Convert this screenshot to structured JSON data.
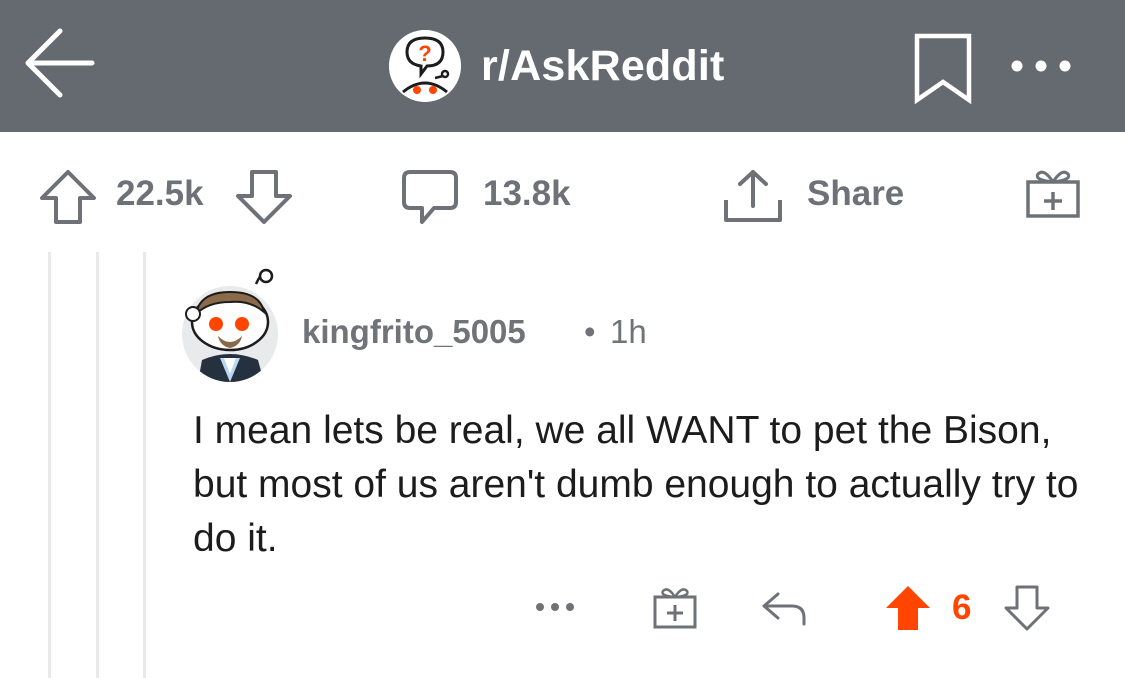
{
  "header": {
    "subreddit": "r/AskReddit",
    "icons": {
      "back": "back-arrow-icon",
      "subreddit": "askreddit-snoo-icon",
      "bookmark": "bookmark-icon",
      "more": "more-horizontal-icon"
    },
    "background_color": "#656a71"
  },
  "post_actions": {
    "upvotes": "22.5k",
    "comments": "13.8k",
    "share_label": "Share",
    "icons": {
      "upvote": "upvote-arrow-icon",
      "downvote": "downvote-arrow-icon",
      "comments": "comment-bubble-icon",
      "share": "share-icon",
      "award": "gift-award-icon"
    }
  },
  "comment": {
    "username": "kingfrito_5005",
    "separator": "•",
    "timestamp": "1h",
    "body": "I mean lets be real, we all WANT to pet the Bison, but most of us aren't dumb enough to actually try to do it.",
    "votes": "6",
    "vote_state": "upvoted",
    "upvote_color": "#ff4500",
    "icons": {
      "avatar": "snoo-avatar",
      "more": "more-horizontal-icon",
      "award": "gift-award-icon",
      "reply": "reply-arrow-icon",
      "upvote": "upvote-arrow-filled-icon",
      "downvote": "downvote-arrow-icon"
    }
  }
}
